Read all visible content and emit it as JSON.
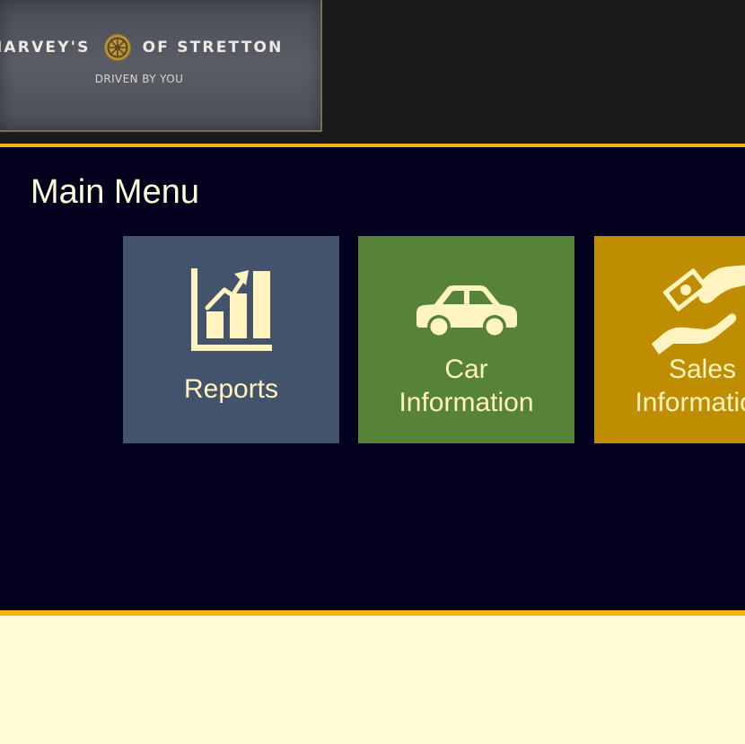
{
  "brand": {
    "name_left": "HARVEY'S",
    "name_right": "OF STRETTON",
    "tagline": "DRIVEN BY YOU",
    "emblem_icon": "wheel-emblem-icon"
  },
  "main_menu": {
    "title": "Main Menu",
    "tiles": [
      {
        "label_lines": [
          "Reports"
        ],
        "icon": "bar-chart-growth-icon",
        "color": "#44536c"
      },
      {
        "label_lines": [
          "Car",
          "Information"
        ],
        "icon": "car-icon",
        "color": "#568338"
      },
      {
        "label_lines": [
          "Sales",
          "Information"
        ],
        "icon": "money-hand-icon",
        "color": "#bf8d00"
      }
    ]
  },
  "theme": {
    "header_bg": "#1b1a1d",
    "menu_bg": "#02001c",
    "accent_gold": "#f2b312",
    "footer_bg": "#fffbd6",
    "text_cream": "#fff3bf"
  }
}
